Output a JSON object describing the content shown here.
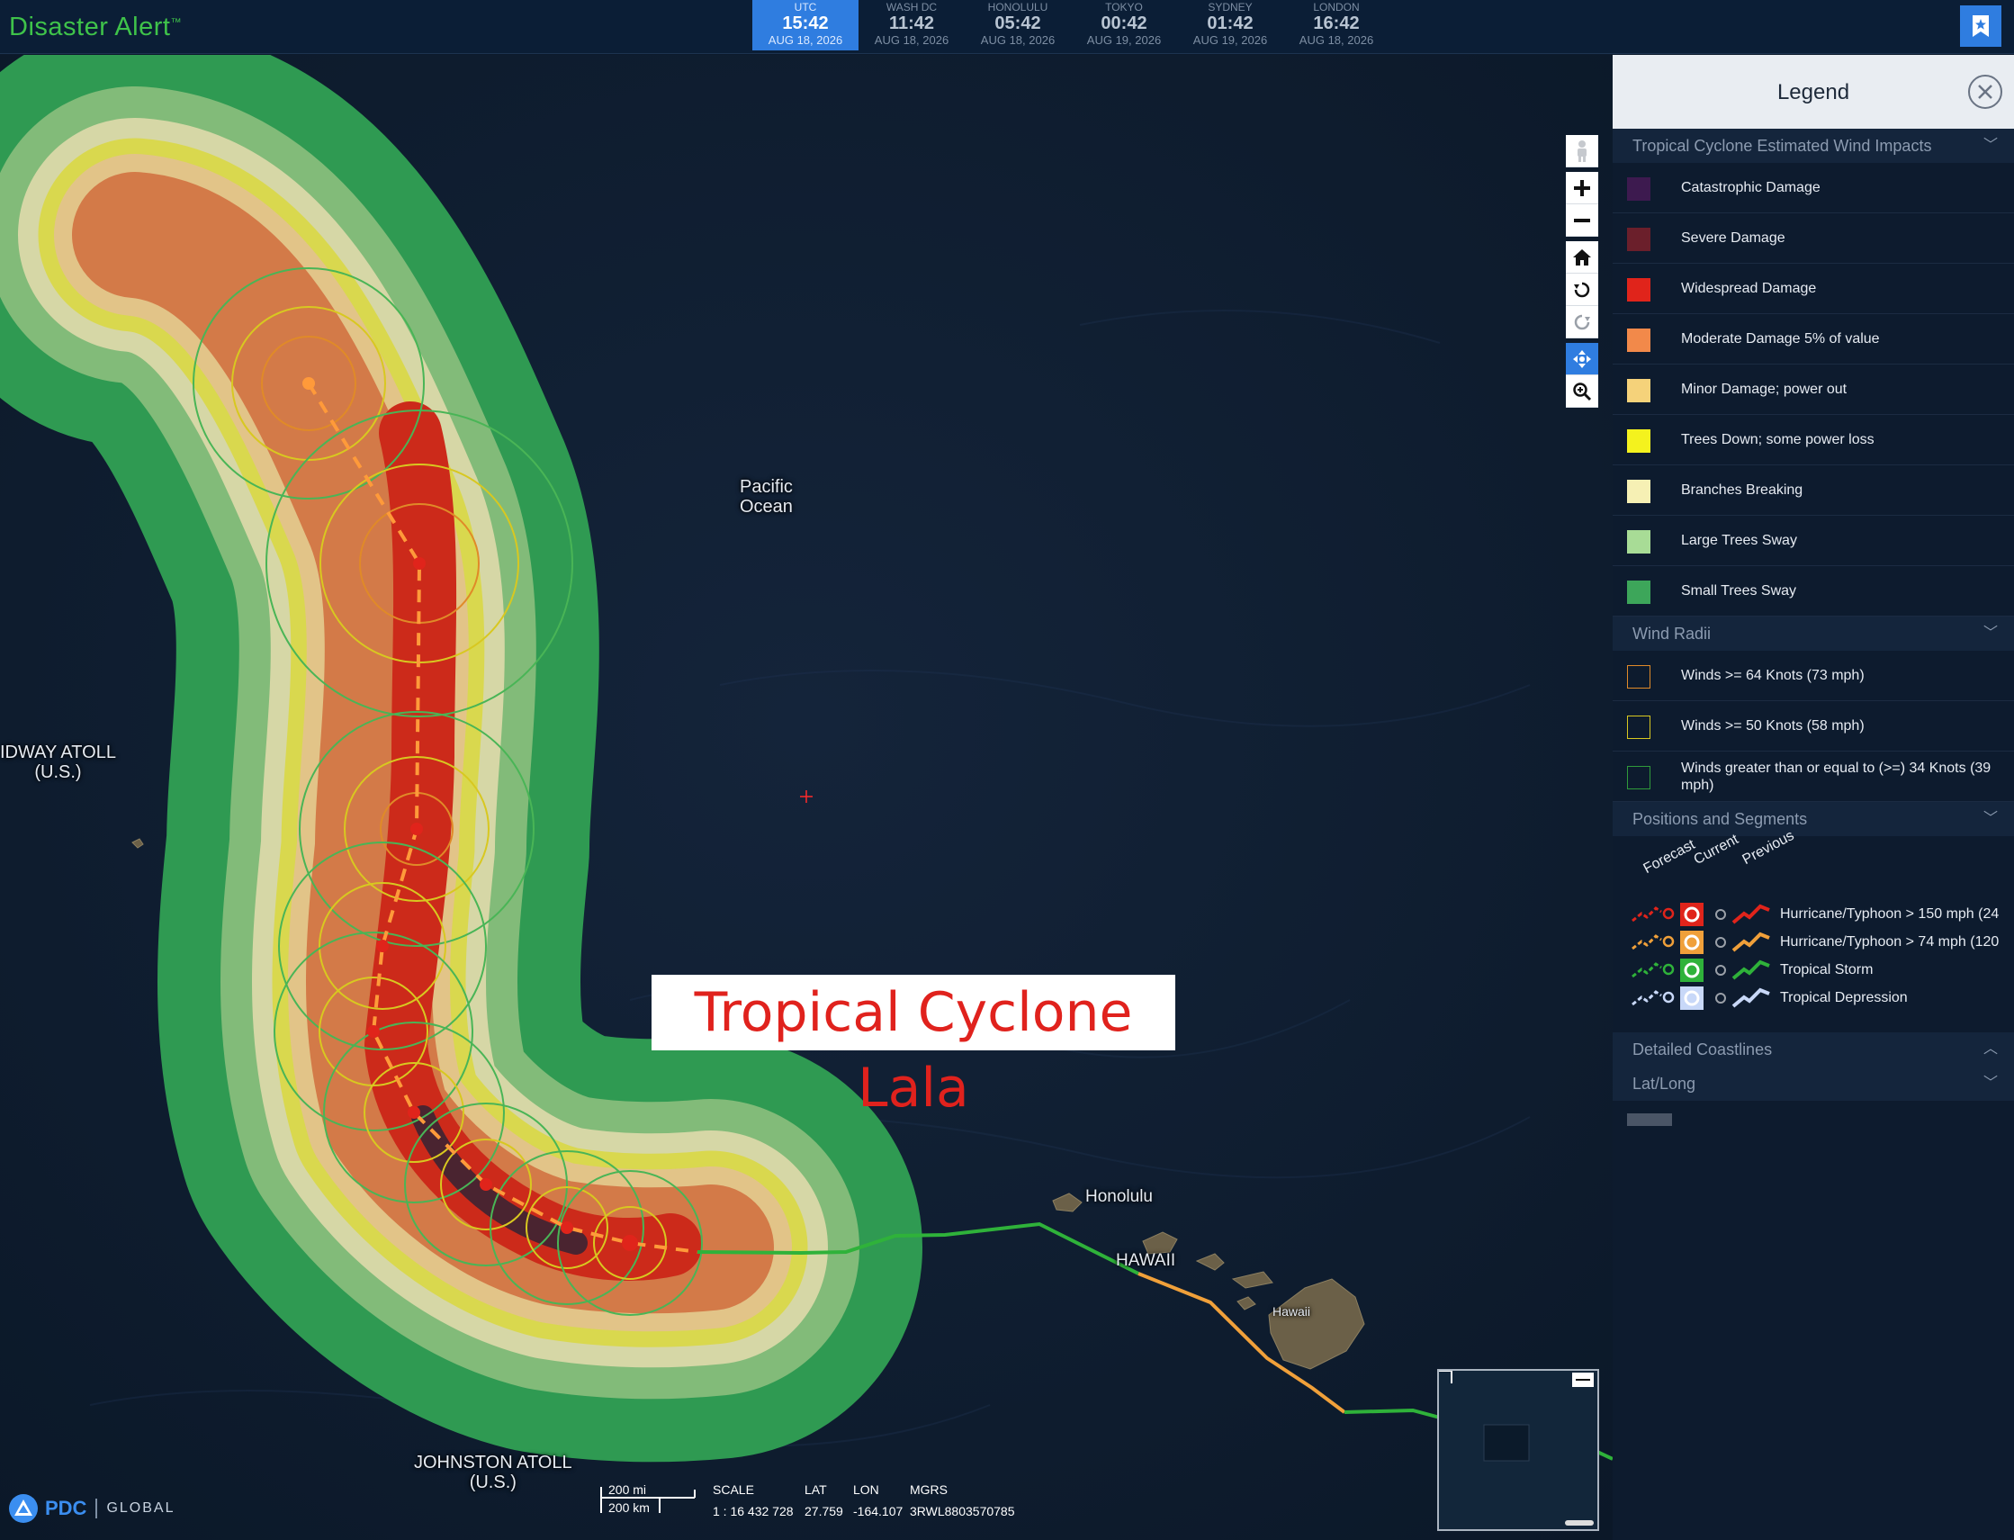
{
  "header": {
    "app_title": "Disaster Alert",
    "app_title_mark": "™",
    "clocks": [
      {
        "city": "UTC",
        "time": "15:42",
        "date": "AUG 18, 2026",
        "active": true
      },
      {
        "city": "WASH DC",
        "time": "11:42",
        "date": "AUG 18, 2026"
      },
      {
        "city": "HONOLULU",
        "time": "05:42",
        "date": "AUG 18, 2026"
      },
      {
        "city": "TOKYO",
        "time": "00:42",
        "date": "AUG 19, 2026"
      },
      {
        "city": "SYDNEY",
        "time": "01:42",
        "date": "AUG 19, 2026"
      },
      {
        "city": "LONDON",
        "time": "16:42",
        "date": "AUG 18, 2026"
      }
    ],
    "bookmark_icon": "star-bookmark-icon"
  },
  "map": {
    "labels": {
      "pacific": "Pacific\nOcean",
      "midway": "IDWAY ATOLL\n(U.S.)",
      "honolulu": "Honolulu",
      "hawaii_state": "HAWAII",
      "hawaii_island": "Hawaii",
      "johnston": "JOHNSTON ATOLL\n(U.S.)"
    },
    "storm_callout": "Tropical Cyclone Lala",
    "tools": [
      "pegman-icon",
      "zoom-in-icon",
      "zoom-out-icon",
      "home-icon",
      "rotate-left-icon",
      "rotate-right-icon",
      "pan-icon",
      "zoom-box-icon"
    ]
  },
  "legend": {
    "title": "Legend",
    "sections": {
      "wind_impacts": "Tropical Cyclone Estimated Wind Impacts",
      "wind_radii": "Wind Radii",
      "positions": "Positions and Segments",
      "coastlines": "Detailed Coastlines",
      "latlong": "Lat/Long"
    },
    "impacts": [
      {
        "label": "Catastrophic Damage",
        "color": "#3d1a4f"
      },
      {
        "label": "Severe Damage",
        "color": "#6b1f2b"
      },
      {
        "label": "Widespread Damage",
        "color": "#e0241b"
      },
      {
        "label": "Moderate Damage 5% of value",
        "color": "#f2894a"
      },
      {
        "label": "Minor Damage; power out",
        "color": "#f5d27a"
      },
      {
        "label": "Trees Down; some power loss",
        "color": "#f4f21e"
      },
      {
        "label": "Branches Breaking",
        "color": "#f6f0b4"
      },
      {
        "label": "Large Trees Sway",
        "color": "#a8dc96"
      },
      {
        "label": "Small Trees Sway",
        "color": "#3da65a"
      }
    ],
    "radii": [
      {
        "label": "Winds >= 64 Knots (73 mph)",
        "color": "#e08a28"
      },
      {
        "label": "Winds >= 50 Knots (58 mph)",
        "color": "#d8c820"
      },
      {
        "label": "Winds greater than or equal to (>=) 34 Knots (39 mph)",
        "color": "#2f9a3a"
      }
    ],
    "positions_headers": {
      "forecast": "Forecast",
      "current": "Current",
      "previous": "Previous"
    },
    "positions_rows": [
      {
        "label": "Hurricane/Typhoon > 150 mph (24",
        "color": "#e0241b"
      },
      {
        "label": "Hurricane/Typhoon > 74 mph (120",
        "color": "#f0a03a"
      },
      {
        "label": "Tropical Storm",
        "color": "#2fb23a"
      },
      {
        "label": "Tropical Depression",
        "color": "#c8d8f8"
      }
    ]
  },
  "bottom": {
    "logo_text": "PDC",
    "logo_global": "GLOBAL",
    "scale_mi": "200 mi",
    "scale_km": "200 km",
    "scale_label": "SCALE",
    "scale_value": "1 : 16 432 728",
    "lat_label": "LAT",
    "lat_value": "27.759",
    "lon_label": "LON",
    "lon_value": "-164.107",
    "mgrs_label": "MGRS",
    "mgrs_value": "3RWL8803570785"
  }
}
